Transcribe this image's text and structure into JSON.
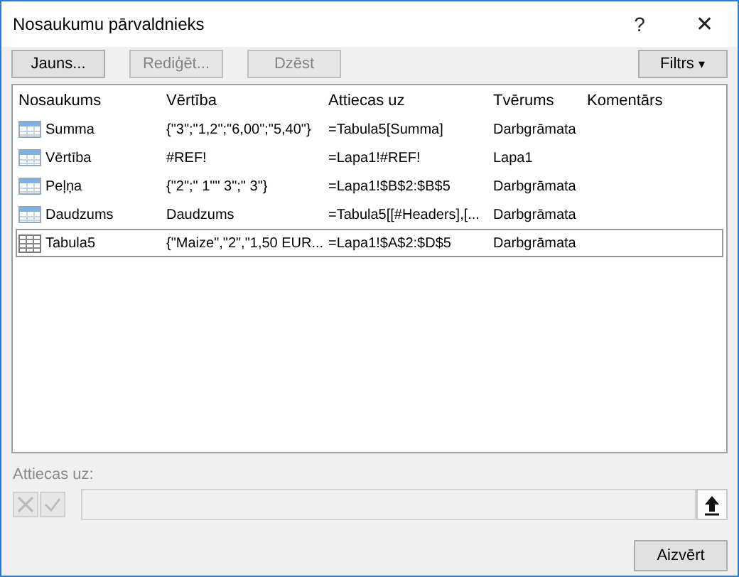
{
  "window": {
    "title": "Nosaukumu pārvaldnieks",
    "help": "?",
    "close": "✕"
  },
  "toolbar": [
    {
      "label": "Jauns...",
      "disabled": false
    },
    {
      "label": "Rediģēt...",
      "disabled": true
    },
    {
      "label": "Dzēst",
      "disabled": true
    }
  ],
  "filter_button": {
    "label": "Filtrs",
    "caret": "▾"
  },
  "table": {
    "columns": [
      "Nosaukums",
      "Vērtība",
      "Attiecas uz",
      "Tvērums",
      "Komentārs"
    ],
    "rows": [
      {
        "kind": "name",
        "selected": false,
        "cells": [
          "Summa",
          "{\"3\";\"1,2\";\"6,00\";\"5,40\"}",
          "=Tabula5[Summa]",
          "Darbgrāmata"
        ]
      },
      {
        "kind": "name",
        "selected": false,
        "cells": [
          "Vērtība",
          "#REF!",
          "=Lapa1!#REF!",
          "Lapa1"
        ]
      },
      {
        "kind": "name",
        "selected": false,
        "cells": [
          "Peļņa",
          "{\"2\";\" 1\"\" 3\";\" 3\"}",
          "=Lapa1!$B$2:$B$5",
          "Darbgrāmata"
        ]
      },
      {
        "kind": "name",
        "selected": false,
        "cells": [
          "Daudzums",
          "Daudzums",
          "=Tabula5[[#Headers],[...",
          "Darbgrāmata"
        ]
      },
      {
        "kind": "table",
        "selected": true,
        "cells": [
          "Tabula5",
          "{\"Maize\",\"2\",\"1,50 EUR...",
          "=Lapa1!$A$2:$D$5",
          "Darbgrāmata"
        ]
      }
    ]
  },
  "refers_to": {
    "label": "Attiecas uz:",
    "disabled": true
  },
  "close_button": "Aizvērt"
}
